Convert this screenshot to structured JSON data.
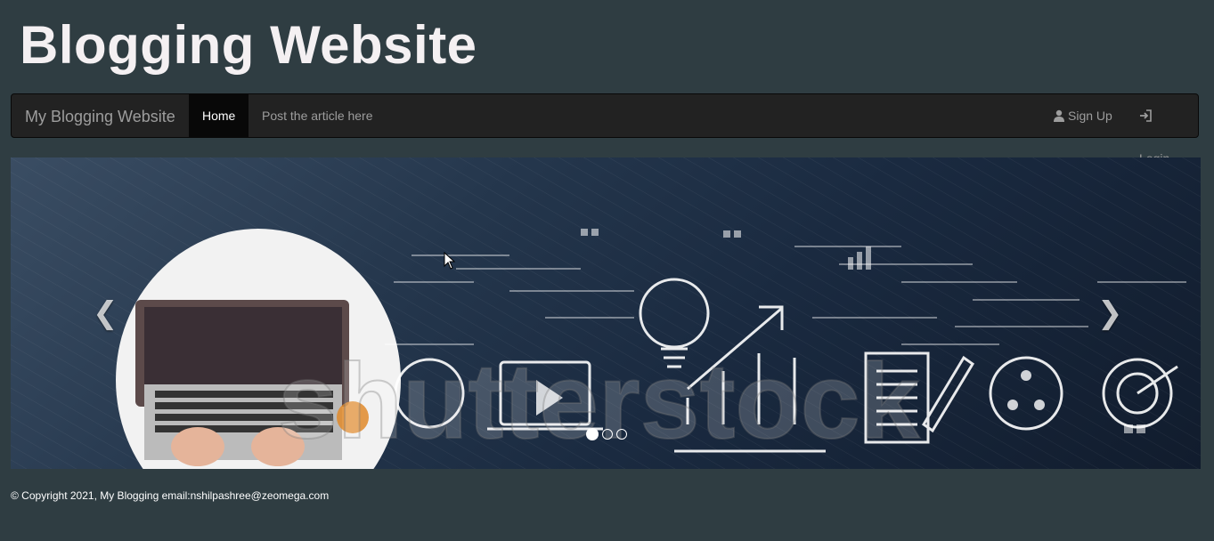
{
  "header": {
    "title": "Blogging Website"
  },
  "navbar": {
    "brand": "My Blogging Website",
    "items": [
      {
        "label": "Home",
        "active": true
      },
      {
        "label": "Post the article here",
        "active": false
      }
    ],
    "right": [
      {
        "label": "Sign Up",
        "icon": "user-icon"
      },
      {
        "label": "Login",
        "icon": "login-icon"
      }
    ]
  },
  "carousel": {
    "prev_glyph": "❮",
    "next_glyph": "❯",
    "indicator_count": 3,
    "active_index": 0,
    "watermark": "shutterstock"
  },
  "footer": {
    "text": "© Copyright 2021, My Blogging email:nshilpashree@zeomega.com"
  },
  "colors": {
    "page_bg": "#2f3d42",
    "navbar_bg": "#222222",
    "title": "#f4f0f2"
  }
}
